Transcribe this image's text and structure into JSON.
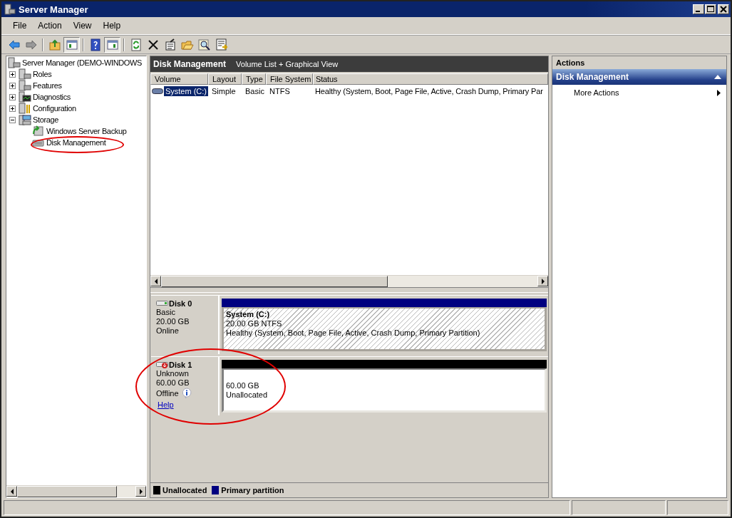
{
  "window": {
    "title": "Server Manager"
  },
  "menu": [
    "File",
    "Action",
    "View",
    "Help"
  ],
  "toolbar": [
    {
      "kind": "back",
      "pressed": false
    },
    {
      "kind": "forward",
      "pressed": false
    },
    {
      "kind": "separator"
    },
    {
      "kind": "up",
      "pressed": false
    },
    {
      "kind": "tree-toggle",
      "pressed": true
    },
    {
      "kind": "separator"
    },
    {
      "kind": "help",
      "pressed": false
    },
    {
      "kind": "pane-toggle",
      "pressed": true
    },
    {
      "kind": "separator"
    },
    {
      "kind": "refresh",
      "pressed": false
    },
    {
      "kind": "delete",
      "pressed": false
    },
    {
      "kind": "properties",
      "pressed": false
    },
    {
      "kind": "open",
      "pressed": false
    },
    {
      "kind": "find",
      "pressed": false
    },
    {
      "kind": "export",
      "pressed": false
    }
  ],
  "tree": {
    "label": "Server Manager (DEMO-WINDOWS",
    "kind": "server",
    "children": [
      {
        "label": "Roles",
        "kind": "server",
        "expanded": false
      },
      {
        "label": "Features",
        "kind": "server",
        "expanded": false
      },
      {
        "label": "Diagnostics",
        "kind": "monitor",
        "expanded": false
      },
      {
        "label": "Configuration",
        "kind": "tools",
        "expanded": false
      },
      {
        "label": "Storage",
        "kind": "storage",
        "expanded": true,
        "children": [
          {
            "label": "Windows Server Backup",
            "kind": "backup"
          },
          {
            "label": "Disk Management",
            "kind": "disk"
          }
        ]
      }
    ]
  },
  "panel": {
    "title": "Disk Management",
    "subtitle": "Volume List + Graphical View"
  },
  "volume_table": {
    "columns": [
      "Volume",
      "Layout",
      "Type",
      "File System",
      "Status"
    ],
    "rows": [
      {
        "cells": [
          "System (C:)",
          "Simple",
          "Basic",
          "NTFS",
          "Healthy (System, Boot, Page File, Active, Crash Dump, Primary Par"
        ],
        "selected": true
      }
    ]
  },
  "disks": [
    {
      "name": "Disk 0",
      "kind": "online",
      "type": "Basic",
      "size": "20.00 GB",
      "status": "Online",
      "info": false,
      "partitions": [
        {
          "kind": "primary",
          "color": "#000080",
          "name": "System  (C:)",
          "lines": [
            "20.00 GB NTFS",
            "Healthy (System, Boot, Page File, Active, Crash Dump, Primary Partition)"
          ]
        }
      ]
    },
    {
      "name": "Disk 1",
      "kind": "offline",
      "type": "Unknown",
      "size": "60.00 GB",
      "status": "Offline",
      "info": true,
      "link": "Help",
      "partitions": [
        {
          "kind": "unallocated",
          "color": "#000000",
          "lines": [
            "60.00 GB",
            "Unallocated"
          ]
        }
      ]
    }
  ],
  "legend": [
    {
      "label": "Unallocated",
      "color": "#000000"
    },
    {
      "label": "Primary partition",
      "color": "#000080"
    }
  ],
  "actions": {
    "title": "Actions",
    "section": {
      "label": "Disk Management",
      "expanded": true
    },
    "items": [
      {
        "label": "More Actions",
        "submenu": true
      }
    ]
  }
}
